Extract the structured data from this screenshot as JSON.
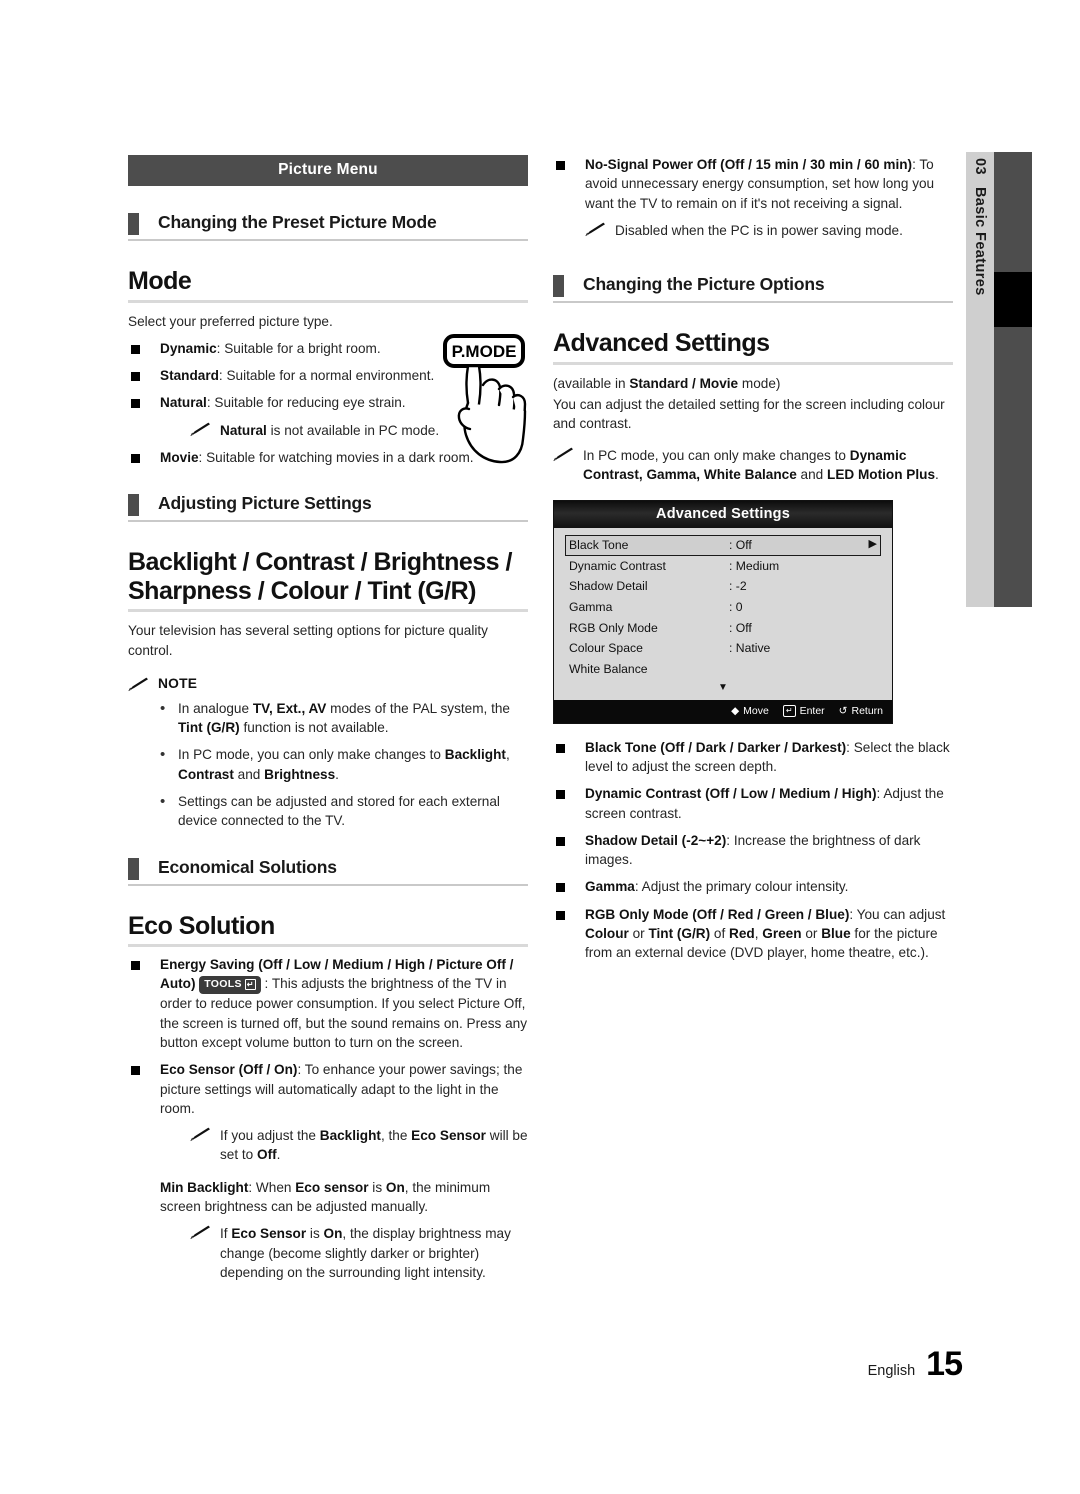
{
  "page": {
    "language_label": "English",
    "page_number": "15",
    "chapter_number": "03",
    "chapter_title": "Basic Features"
  },
  "left_column": {
    "menu_bar": "Picture Menu",
    "section1": {
      "heading": "Changing the Preset Picture Mode",
      "title": "Mode",
      "intro": "Select your preferred picture type.",
      "items": [
        "Dynamic: Suitable for a bright room.",
        "Standard: Suitable for a normal environment.",
        "Natural: Suitable for reducing eye strain.",
        "Movie: Suitable for watching movies in a dark room."
      ],
      "natural_note": "Natural is not available in PC mode.",
      "remote_button_label": "P.MODE"
    },
    "section2": {
      "heading": "Adjusting Picture Settings",
      "title": "Backlight / Contrast / Brightness / Sharpness / Colour / Tint (G/R)",
      "intro": "Your television has several setting options for picture quality control.",
      "note_head": "NOTE",
      "notes": [
        "In analogue TV, Ext., AV modes of the PAL system, the Tint (G/R) function is not available.",
        "In PC mode, you can only make changes to Backlight, Contrast and Brightness.",
        "Settings can be adjusted and stored for each external device connected to the TV."
      ]
    },
    "section3": {
      "heading": "Economical Solutions",
      "title": "Eco Solution",
      "energy_saving_label": "Energy Saving (Off / Low / Medium / High / Picture Off / Auto)",
      "tools_badge": "TOOLS",
      "energy_saving_text": ": This adjusts the brightness of the TV in order to reduce power consumption. If you select Picture Off, the screen is turned off, but the sound remains on. Press any button except volume button to turn on the screen.",
      "eco_sensor_label": "Eco Sensor (Off / On)",
      "eco_sensor_text": ": To enhance your power savings; the picture settings will automatically adapt to the light in the room.",
      "eco_sensor_note": "If you adjust the Backlight, the Eco Sensor will be set to Off.",
      "min_backlight_label": "Min Backlight",
      "min_backlight_text": ": When Eco sensor is On, the minimum screen brightness can be adjusted manually.",
      "min_backlight_note": "If Eco Sensor is On, the display brightness may change (become slightly darker or brighter) depending on the surrounding light intensity."
    }
  },
  "right_column": {
    "no_signal": {
      "label": "No-Signal Power Off (Off / 15 min / 30 min / 60 min)",
      "text": ": To avoid unnecessary energy consumption, set how long you want the TV to remain on if it's not receiving a signal.",
      "note": "Disabled when the PC is in power saving mode."
    },
    "section_heading": "Changing the Picture Options",
    "title": "Advanced Settings",
    "availability": "(available in Standard / Movie mode)",
    "intro": "You can adjust the detailed setting for the screen including colour and contrast.",
    "pc_note": "In PC mode, you can only make changes to Dynamic Contrast, Gamma, White Balance and LED Motion Plus.",
    "osd": {
      "title": "Advanced Settings",
      "rows": [
        {
          "name": "Black Tone",
          "value": ": Off",
          "selected": true,
          "chevron": "▶"
        },
        {
          "name": "Dynamic Contrast",
          "value": ": Medium",
          "selected": false,
          "chevron": ""
        },
        {
          "name": "Shadow Detail",
          "value": ": -2",
          "selected": false,
          "chevron": ""
        },
        {
          "name": "Gamma",
          "value": ": 0",
          "selected": false,
          "chevron": ""
        },
        {
          "name": "RGB Only Mode",
          "value": ": Off",
          "selected": false,
          "chevron": ""
        },
        {
          "name": "Colour Space",
          "value": ": Native",
          "selected": false,
          "chevron": ""
        },
        {
          "name": "White Balance",
          "value": "",
          "selected": false,
          "chevron": ""
        }
      ],
      "scroll_glyph": "▼",
      "footer": {
        "move": "Move",
        "enter": "Enter",
        "return": "Return",
        "return_glyph": "↺"
      }
    },
    "options": [
      {
        "label": "Black Tone (Off / Dark / Darker / Darkest)",
        "text": ": Select the black level to adjust the screen depth."
      },
      {
        "label": "Dynamic Contrast (Off / Low / Medium / High)",
        "text": ": Adjust the screen contrast."
      },
      {
        "label": "Shadow Detail (-2~+2)",
        "text": ": Increase the brightness of dark images."
      },
      {
        "label": "Gamma",
        "text": ": Adjust the primary colour intensity."
      },
      {
        "label": "RGB Only Mode (Off / Red / Green / Blue)",
        "text": ": You can adjust Colour or Tint (G/R) of Red, Green or Blue for the picture from an external device (DVD player, home theatre, etc.)."
      }
    ]
  },
  "colors": {
    "bar_dark": "#4d4d4d",
    "rule_light": "#d9d9d9",
    "tab_light": "#cfcfcf",
    "tab_active": "#000000"
  }
}
